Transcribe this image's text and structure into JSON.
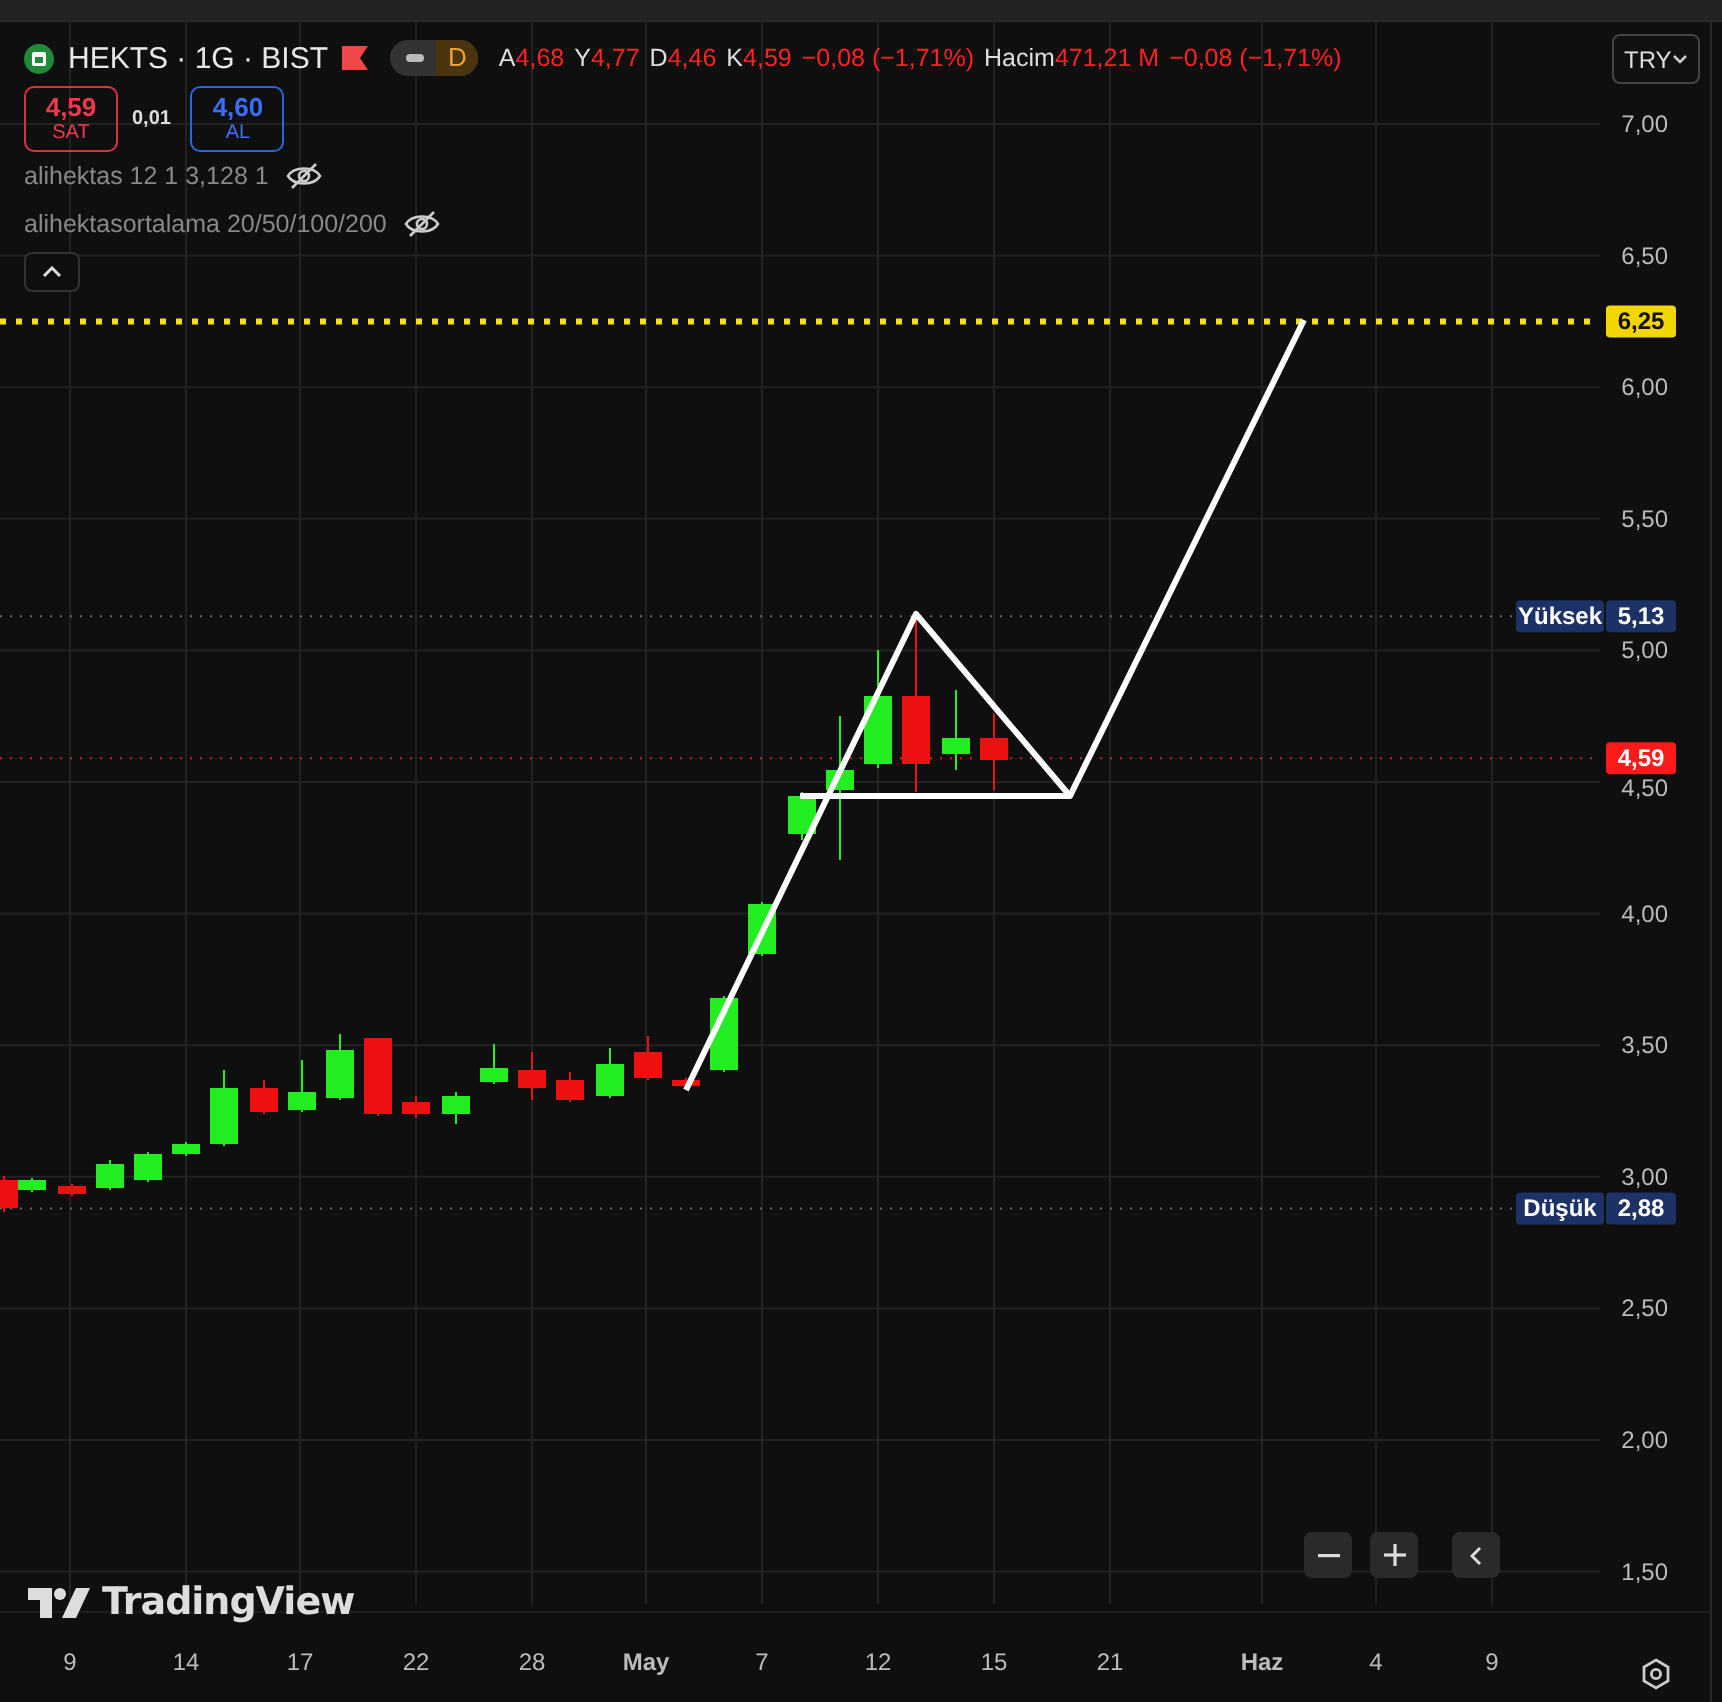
{
  "symbol": {
    "title": "HEKTS · 1G · BIST",
    "interval_badge": "D"
  },
  "ohlc": [
    {
      "label": "A",
      "value": "4,68"
    },
    {
      "label": "Y",
      "value": "4,77"
    },
    {
      "label": "D",
      "value": "4,46"
    },
    {
      "label": "K",
      "value": "4,59"
    }
  ],
  "change": "−0,08 (−1,71%)",
  "volume": {
    "label": "Hacim",
    "value": "471,21 M",
    "change": "−0,08 (−1,71%)"
  },
  "trade": {
    "sell_price": "4,59",
    "sell_label": "SAT",
    "spread": "0,01",
    "buy_price": "4,60",
    "buy_label": "AL"
  },
  "indicators": [
    {
      "name": "alihektas 12 1 3,128 1",
      "visible": false
    },
    {
      "name": "alihektasortalama 20/50/100/200",
      "visible": false
    }
  ],
  "currency": "TRY",
  "price_axis": {
    "ticks": [
      "7,00",
      "6,50",
      "6,00",
      "5,50",
      "5,00",
      "4,50",
      "4,00",
      "3,50",
      "3,00",
      "2,50",
      "2,00",
      "1,50"
    ],
    "markers": [
      {
        "kind": "target",
        "value": "6,25"
      },
      {
        "kind": "high",
        "label": "Yüksek",
        "value": "5,13"
      },
      {
        "kind": "last",
        "value": "4,59"
      },
      {
        "kind": "low",
        "label": "Düşük",
        "value": "2,88"
      }
    ]
  },
  "time_axis": [
    {
      "label": "9",
      "kind": "day"
    },
    {
      "label": "14",
      "kind": "day"
    },
    {
      "label": "17",
      "kind": "day"
    },
    {
      "label": "22",
      "kind": "day"
    },
    {
      "label": "28",
      "kind": "day"
    },
    {
      "label": "May",
      "kind": "month"
    },
    {
      "label": "7",
      "kind": "day"
    },
    {
      "label": "12",
      "kind": "day"
    },
    {
      "label": "15",
      "kind": "day"
    },
    {
      "label": "21",
      "kind": "day"
    },
    {
      "label": "Haz",
      "kind": "month"
    },
    {
      "label": "4",
      "kind": "day"
    },
    {
      "label": "9",
      "kind": "day"
    }
  ],
  "logo": "TradingView"
}
